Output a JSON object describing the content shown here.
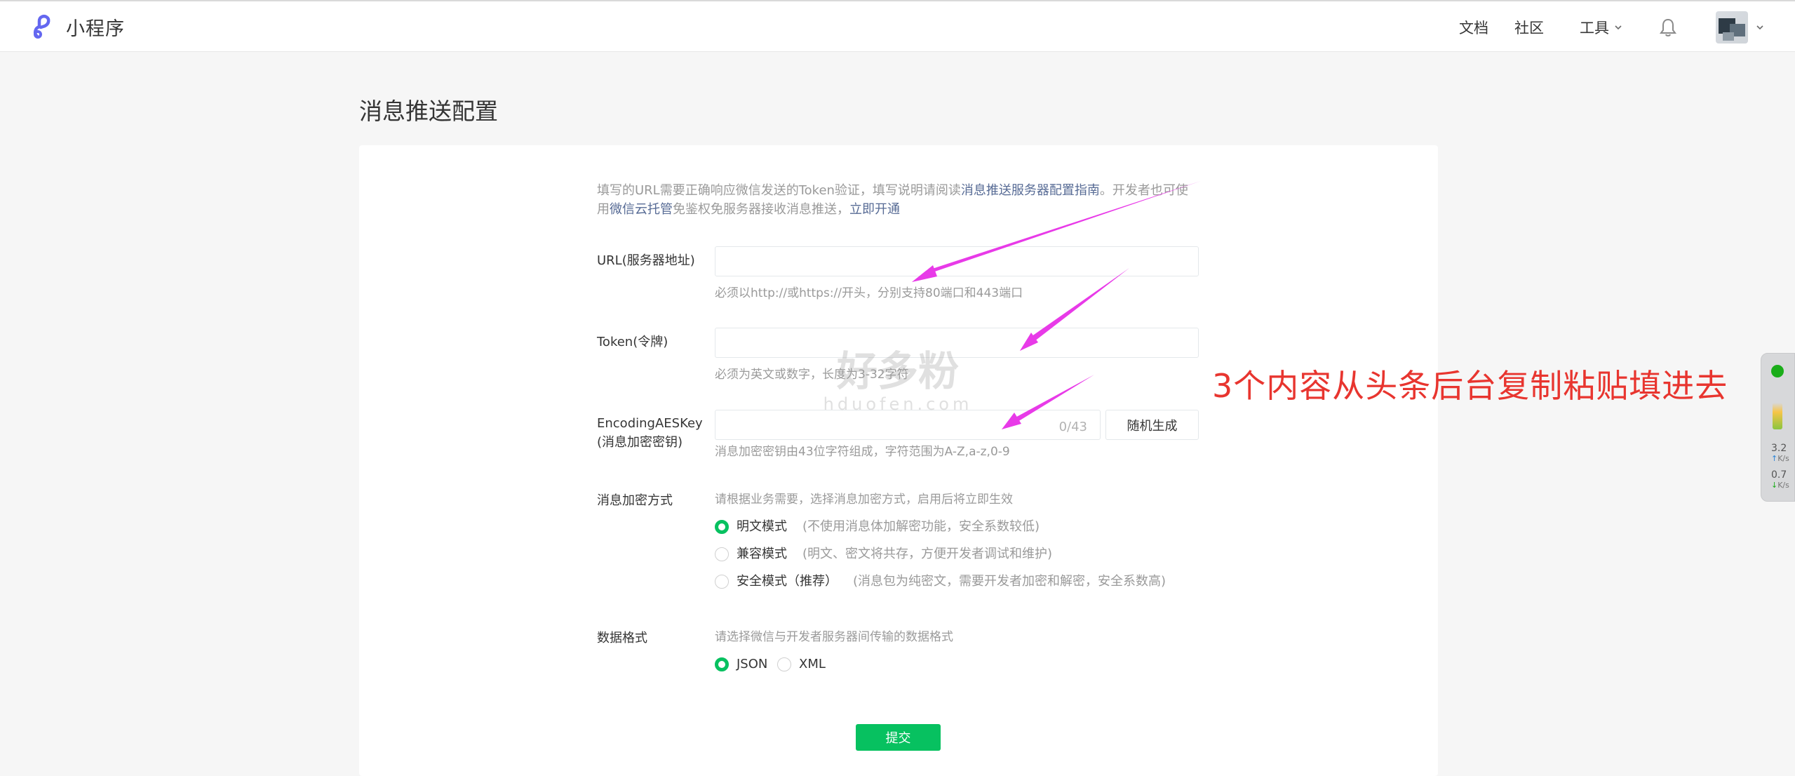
{
  "header": {
    "brand": "小程序",
    "nav": {
      "docs": "文档",
      "community": "社区",
      "tools": "工具"
    }
  },
  "page": {
    "title": "消息推送配置"
  },
  "intro": {
    "text1": "填写的URL需要正确响应微信发送的Token验证，填写说明请阅读",
    "link_guide": "消息推送服务器配置指南",
    "text2": "。开发者也可使用",
    "link_cloud": "微信云托管",
    "text3": "免鉴权免服务器接收消息推送，",
    "link_enable": "立即开通"
  },
  "form": {
    "url": {
      "label": "URL(服务器地址)",
      "value": "",
      "hint": "必须以http://或https://开头，分别支持80端口和443端口"
    },
    "token": {
      "label": "Token(令牌)",
      "value": "",
      "hint": "必须为英文或数字，长度为3-32字符"
    },
    "aeskey": {
      "label_line1": "EncodingAESKey",
      "label_line2": "(消息加密密钥)",
      "value": "",
      "counter": "0/43",
      "generate": "随机生成",
      "hint": "消息加密密钥由43位字符组成，字符范围为A-Z,a-z,0-9"
    },
    "encrypt": {
      "label": "消息加密方式",
      "hint": "请根据业务需要，选择消息加密方式，启用后将立即生效",
      "selected": "明文模式",
      "options": [
        {
          "label": "明文模式",
          "desc": "(不使用消息体加解密功能，安全系数较低)"
        },
        {
          "label": "兼容模式",
          "desc": "(明文、密文将共存，方便开发者调试和维护)"
        },
        {
          "label": "安全模式（推荐）",
          "desc": "(消息包为纯密文，需要开发者加密和解密，安全系数高)"
        }
      ]
    },
    "format": {
      "label": "数据格式",
      "hint": "请选择微信与开发者服务器间传输的数据格式",
      "selected": "JSON",
      "options": [
        "JSON",
        "XML"
      ]
    },
    "submit": "提交"
  },
  "overlay": {
    "annotation": "3个内容从头条后台复制粘贴填进去",
    "annotation_color": "#e8352f",
    "arrow_color": "#e83ae8",
    "watermark_main": "好多粉",
    "watermark_sub": "hduofen.com"
  },
  "network": {
    "upload": "3.2",
    "download": "0.7",
    "unit": "K/s"
  },
  "colors": {
    "accent": "#07c160",
    "link": "#576b95"
  }
}
